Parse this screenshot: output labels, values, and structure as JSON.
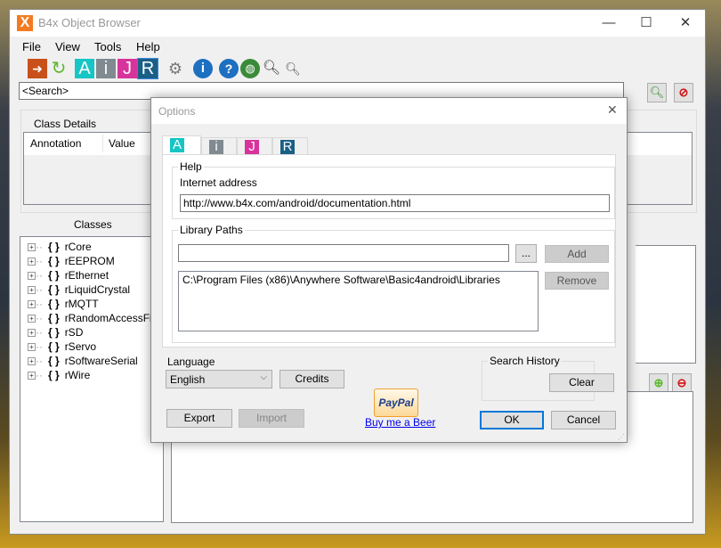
{
  "window": {
    "title": "B4x Object Browser",
    "logo": "X",
    "minimize": "—",
    "maximize": "☐",
    "close": "✕"
  },
  "menu": [
    "File",
    "View",
    "Tools",
    "Help"
  ],
  "toolbar": {
    "icons": [
      "exit-icon",
      "refresh-icon",
      "b4a-icon",
      "b4i-icon",
      "b4j-icon",
      "b4r-icon",
      "settings-icon",
      "info-icon",
      "help-icon",
      "globe-icon",
      "search-icon",
      "search-file-icon"
    ],
    "letters": [
      "A",
      "i",
      "J",
      "R"
    ],
    "colors": {
      "A": "#16c5c5",
      "i": "#808a90",
      "J": "#d8339c",
      "R": "#1a5f86"
    }
  },
  "search": {
    "value": "<Search>"
  },
  "class_details": {
    "title": "Class Details",
    "columns": [
      "Annotation",
      "Value"
    ]
  },
  "classes": {
    "title": "Classes",
    "items": [
      "rCore",
      "rEEPROM",
      "rEthernet",
      "rLiquidCrystal",
      "rMQTT",
      "rRandomAccessFile",
      "rSD",
      "rServo",
      "rSoftwareSerial",
      "rWire"
    ]
  },
  "options": {
    "title": "Options",
    "close": "✕",
    "tabs": [
      "A",
      "i",
      "J",
      "R"
    ],
    "help": {
      "title": "Help",
      "label": "Internet address",
      "url": "http://www.b4x.com/android/documentation.html"
    },
    "library": {
      "title": "Library Paths",
      "input": "",
      "browse": "...",
      "add": "Add",
      "remove": "Remove",
      "paths": [
        "C:\\Program Files (x86)\\Anywhere Software\\Basic4android\\Libraries"
      ]
    },
    "language": {
      "label": "Language",
      "value": "English",
      "credits": "Credits"
    },
    "search_history": {
      "title": "Search History",
      "clear": "Clear"
    },
    "export": "Export",
    "import": "Import",
    "paypal": {
      "logo": "PayPal",
      "link": "Buy me a Beer"
    },
    "ok": "OK",
    "cancel": "Cancel"
  }
}
